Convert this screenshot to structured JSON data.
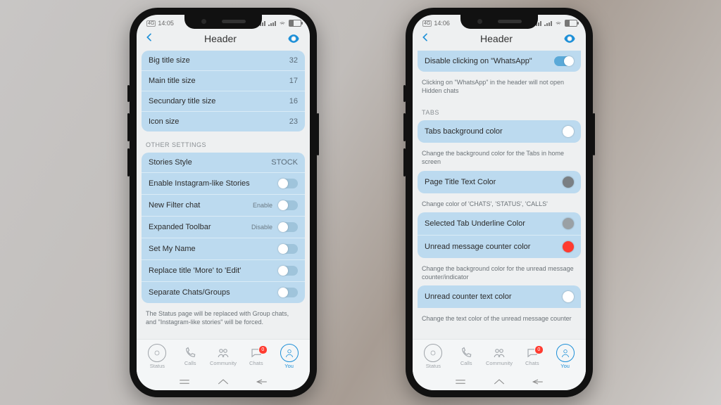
{
  "colors": {
    "accent": "#1e90d8",
    "card": "#bcdaef",
    "swatch_white": "#ffffff",
    "swatch_gray": "#7a7f83",
    "swatch_red": "#ff3b30"
  },
  "left": {
    "status": {
      "time": "14:05",
      "net": "4G"
    },
    "title": "Header",
    "sizes": {
      "rows": [
        {
          "label": "Big title size",
          "value": "32"
        },
        {
          "label": "Main title size",
          "value": "17"
        },
        {
          "label": "Secundary title size",
          "value": "16"
        },
        {
          "label": "Icon size",
          "value": "23"
        }
      ]
    },
    "section_other": "OTHER SETTINGS",
    "other": {
      "stories_style": {
        "label": "Stories Style",
        "value": "STOCK"
      },
      "ig_stories": {
        "label": "Enable Instagram-like Stories"
      },
      "new_filter": {
        "label": "New Filter chat",
        "sublabel": "Enable"
      },
      "expanded_tb": {
        "label": "Expanded Toolbar",
        "sublabel": "Disable"
      },
      "set_my_name": {
        "label": "Set My Name"
      },
      "replace_title": {
        "label": "Replace title 'More' to 'Edit'"
      },
      "separate": {
        "label": "Separate Chats/Groups"
      }
    },
    "other_hint": "The Status page will be replaced with Group chats, and \"Instagram-like stories\" will be forced."
  },
  "right": {
    "status": {
      "time": "14:06",
      "net": "4G"
    },
    "title": "Header",
    "disable_click": {
      "label": "Disable clicking on \"WhatsApp\"",
      "hint": "Clicking on \"WhatsApp\" in the header will not open Hidden chats"
    },
    "section_tabs": "TABS",
    "tabs_bg": {
      "label": "Tabs background color",
      "hint": "Change the background color for the Tabs in home screen"
    },
    "page_title_color": {
      "label": "Page Title Text Color",
      "hint": "Change color of 'CHATS', 'STATUS', 'CALLS'"
    },
    "sel_underline": {
      "label": "Selected Tab Underline Color"
    },
    "unread_color": {
      "label": "Unread message counter color"
    },
    "unread_hint": "Change the background color for the unread message counter/indicator",
    "unread_text": {
      "label": "Unread counter text color",
      "hint": "Change the text color of the unread message counter"
    }
  },
  "tabs": {
    "status": "Status",
    "calls": "Calls",
    "community": "Community",
    "chats": "Chats",
    "chats_badge": "0",
    "you": "You"
  }
}
